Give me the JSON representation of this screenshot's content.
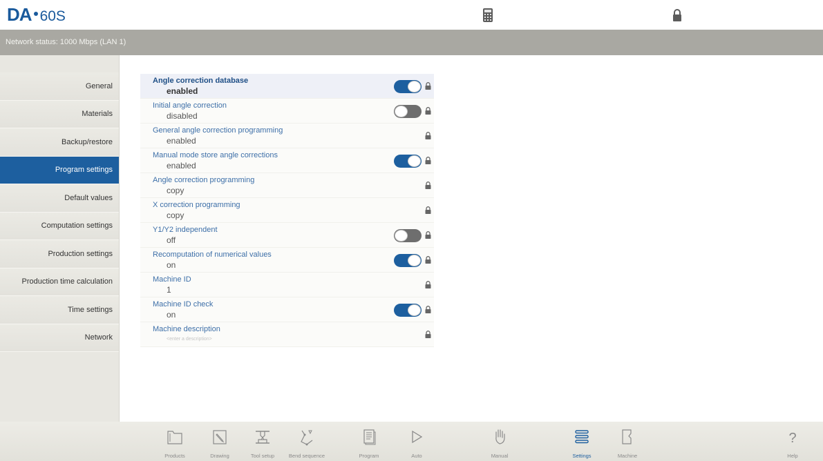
{
  "app": {
    "logo_brand": "DA",
    "logo_model": "60S"
  },
  "status": {
    "network": "Network status: 1000 Mbps (LAN 1)"
  },
  "colors": {
    "accent": "#1d5f9f",
    "statusbar": "#a9a8a2",
    "sidebar": "#e8e7e1"
  },
  "header_icons": [
    "calculator-icon",
    "lock-icon"
  ],
  "sidebar": {
    "items": [
      {
        "label": "General",
        "active": false
      },
      {
        "label": "Materials",
        "active": false
      },
      {
        "label": "Backup/restore",
        "active": false
      },
      {
        "label": "Program settings",
        "active": true
      },
      {
        "label": "Default values",
        "active": false
      },
      {
        "label": "Computation settings",
        "active": false
      },
      {
        "label": "Production settings",
        "active": false
      },
      {
        "label": "Production time calculation",
        "active": false
      },
      {
        "label": "Time settings",
        "active": false
      },
      {
        "label": "Network",
        "active": false
      }
    ]
  },
  "settings": [
    {
      "title": "Angle correction database",
      "value": "enabled",
      "toggle": "on",
      "locked": true,
      "selected": true
    },
    {
      "title": "Initial angle correction",
      "value": "disabled",
      "toggle": "off",
      "locked": true
    },
    {
      "title": "General angle correction programming",
      "value": "enabled",
      "toggle": "none",
      "locked": true
    },
    {
      "title": "Manual mode store angle corrections",
      "value": "enabled",
      "toggle": "on",
      "locked": true
    },
    {
      "title": "Angle correction programming",
      "value": "copy",
      "toggle": "none",
      "locked": true
    },
    {
      "title": "X correction programming",
      "value": "copy",
      "toggle": "none",
      "locked": true
    },
    {
      "title": "Y1/Y2 independent",
      "value": "off",
      "toggle": "off",
      "locked": true
    },
    {
      "title": "Recomputation of numerical values",
      "value": "on",
      "toggle": "on",
      "locked": true
    },
    {
      "title": "Machine ID",
      "value": "1",
      "toggle": "none",
      "locked": true
    },
    {
      "title": "Machine ID check",
      "value": "on",
      "toggle": "on",
      "locked": true
    },
    {
      "title": "Machine description",
      "value": "",
      "placeholder": "<enter a description>",
      "toggle": "none",
      "locked": true
    }
  ],
  "bottom_nav": [
    {
      "label": "Products",
      "icon": "folder-icon"
    },
    {
      "label": "Drawing",
      "icon": "pencil-icon"
    },
    {
      "label": "Tool setup",
      "icon": "tool-setup-icon"
    },
    {
      "label": "Bend sequence",
      "icon": "bend-sequence-icon"
    },
    {
      "label": "Program",
      "icon": "program-icon"
    },
    {
      "label": "Auto",
      "icon": "play-icon"
    },
    {
      "label": "Manual",
      "icon": "hand-icon"
    },
    {
      "label": "Settings",
      "icon": "settings-list-icon",
      "active": true
    },
    {
      "label": "Machine",
      "icon": "machine-icon"
    },
    {
      "label": "Help",
      "icon": "help-icon"
    }
  ]
}
